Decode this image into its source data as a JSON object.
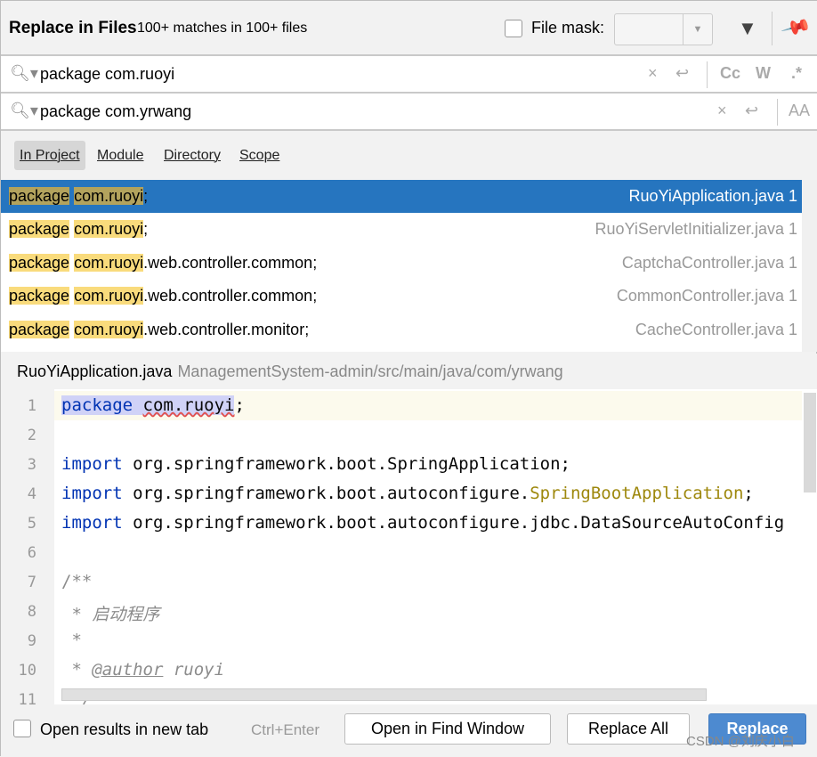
{
  "header": {
    "title": "Replace in Files",
    "matches": "100+ matches in 100+ files",
    "file_mask_label": "File mask:",
    "file_mask_checked": false,
    "icons": [
      "filter-icon",
      "pin-icon"
    ]
  },
  "search": {
    "value": "package com.ruoyi",
    "options": [
      "Cc",
      "W",
      ".*"
    ]
  },
  "replace": {
    "value": "package com.yrwang",
    "options": [
      "AA"
    ]
  },
  "scope": {
    "tabs": [
      "In Project",
      "Module",
      "Directory",
      "Scope"
    ],
    "active": "In Project"
  },
  "results": [
    {
      "match1": "package",
      "match2": "com.ruoyi",
      "rest": ";",
      "file": "RuoYiApplication.java 1",
      "selected": true
    },
    {
      "match1": "package",
      "match2": "com.ruoyi",
      "rest": ";",
      "file": "RuoYiServletInitializer.java 1"
    },
    {
      "match1": "package",
      "match2": "com.ruoyi",
      "rest": ".web.controller.common;",
      "file": "CaptchaController.java 1"
    },
    {
      "match1": "package",
      "match2": "com.ruoyi",
      "rest": ".web.controller.common;",
      "file": "CommonController.java 1"
    },
    {
      "match1": "package",
      "match2": "com.ruoyi",
      "rest": ".web.controller.monitor;",
      "file": "CacheController.java 1"
    }
  ],
  "preview": {
    "file": "RuoYiApplication.java",
    "path": "ManagementSystem-admin/src/main/java/com/yrwang",
    "lines": [
      "1",
      "2",
      "3",
      "4",
      "5",
      "6",
      "7",
      "8",
      "9",
      "10",
      "11"
    ],
    "code": {
      "l1a": "package",
      "l1b": "com.ruoyi",
      "l3a": "import",
      "l3b": " org.springframework.boot.SpringApplication;",
      "l4a": "import",
      "l4b": " org.springframework.boot.autoconfigure.",
      "l4c": "SpringBootApplication",
      "l4d": ";",
      "l5a": "import",
      "l5b": " org.springframework.boot.autoconfigure.jdbc.DataSourceAutoConfig",
      "l7": "/**",
      "l8": " * 启动程序",
      "l9": " *",
      "l10a": " * ",
      "l10b": "@author",
      "l10c": " ruoyi",
      "l11": " */"
    }
  },
  "footer": {
    "open_new_tab": "Open results in new tab",
    "shortcut": "Ctrl+Enter",
    "open_find": "Open in Find Window",
    "replace_all": "Replace All",
    "replace": "Replace",
    "watermark": "CSDN @刘庆小白"
  },
  "colors": {
    "selection": "#2675bf",
    "match": "#f9db7c",
    "primary_button": "#4d8ad0"
  }
}
